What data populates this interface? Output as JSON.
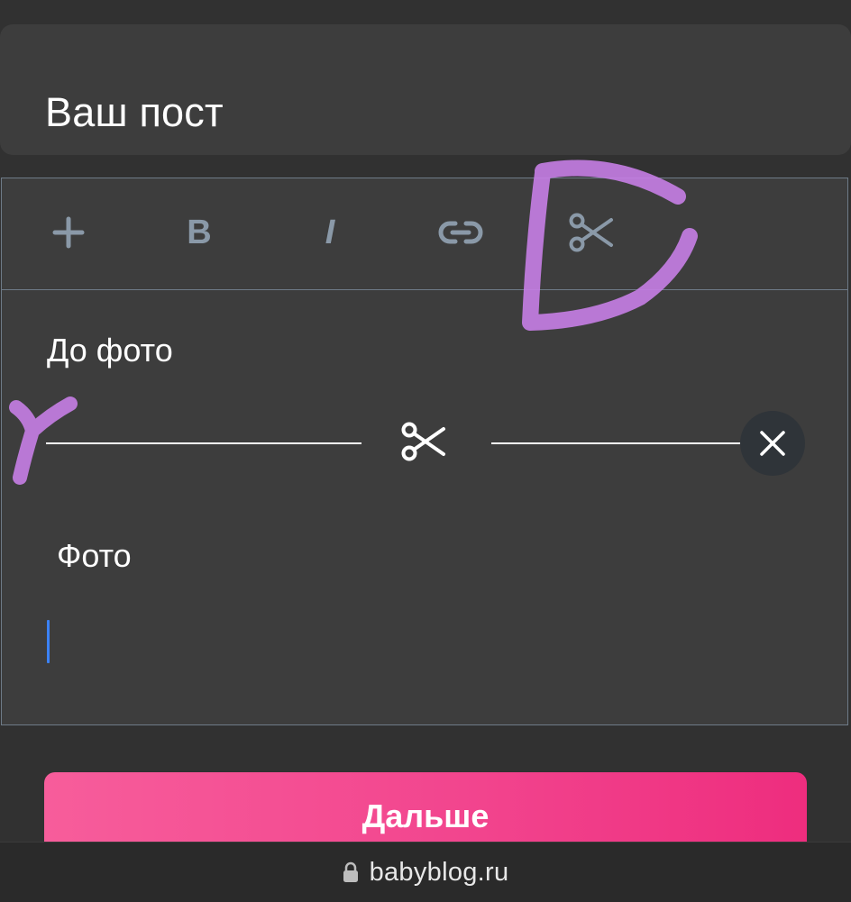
{
  "header": {
    "title": "Ваш пост"
  },
  "toolbar": {
    "buttons": [
      {
        "name": "add",
        "icon": "plus-icon"
      },
      {
        "name": "bold",
        "label": "B"
      },
      {
        "name": "italic",
        "label": "I"
      },
      {
        "name": "link",
        "icon": "link-icon"
      },
      {
        "name": "cut",
        "icon": "scissors-icon"
      }
    ]
  },
  "editor": {
    "paragraph_before": "До фото",
    "separator_icon": "scissors-icon",
    "remove_icon": "close-icon",
    "paragraph_after": "Фото"
  },
  "actions": {
    "next_label": "Дальше"
  },
  "browser": {
    "url": "babyblog.ru",
    "lock_icon": "lock-icon"
  },
  "colors": {
    "background": "#313131",
    "card": "#3d3d3d",
    "toolbar_icon": "#8a99a8",
    "border": "#6e7b88",
    "caret": "#3b82f6",
    "button_gradient_start": "#f75d9b",
    "button_gradient_end": "#ee2d7e",
    "annotation": "#c77ee6"
  }
}
